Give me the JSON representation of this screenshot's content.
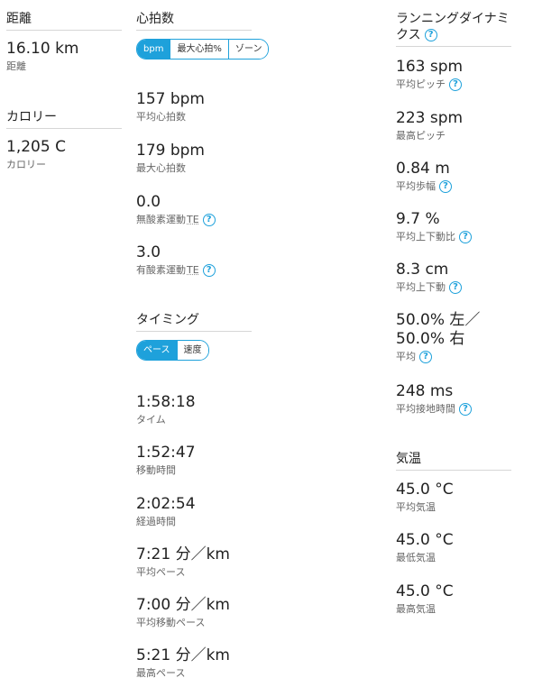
{
  "distance": {
    "title": "距離",
    "value": "16.10 km",
    "label": "距離"
  },
  "calories": {
    "title": "カロリー",
    "value": "1,205 C",
    "label": "カロリー"
  },
  "heart_rate": {
    "title": "心拍数",
    "toggle": [
      "bpm",
      "最大心拍%",
      "ゾーン"
    ],
    "stats": [
      {
        "value": "157 bpm",
        "label": "平均心拍数"
      },
      {
        "value": "179 bpm",
        "label": "最大心拍数"
      },
      {
        "value": "0.0",
        "label": "無酸素運動",
        "suffix": "TE"
      },
      {
        "value": "3.0",
        "label": "有酸素運動",
        "suffix": "TE"
      }
    ]
  },
  "timing": {
    "title": "タイミング",
    "toggle": [
      "ペース",
      "速度"
    ],
    "stats": [
      {
        "value": "1:58:18",
        "label": "タイム"
      },
      {
        "value": "1:52:47",
        "label": "移動時間"
      },
      {
        "value": "2:02:54",
        "label": "経過時間"
      },
      {
        "value": "7:21 分／km",
        "label": "平均ペース"
      },
      {
        "value": "7:00 分／km",
        "label": "平均移動ペース"
      },
      {
        "value": "5:21 分／km",
        "label": "最高ペース"
      }
    ]
  },
  "running_dynamics": {
    "title_line1": "ランニングダイナミ",
    "title_line2": "クス",
    "stats": [
      {
        "value": "163 spm",
        "label": "平均ピッチ"
      },
      {
        "value": "223 spm",
        "label": "最高ピッチ"
      },
      {
        "value": "0.84 m",
        "label": "平均歩幅"
      },
      {
        "value": "9.7 %",
        "label": "平均上下動比"
      },
      {
        "value": "8.3 cm",
        "label": "平均上下動"
      },
      {
        "value_line1": "50.0% 左／",
        "value_line2": "50.0% 右",
        "label": "平均"
      },
      {
        "value": "248 ms",
        "label": "平均接地時間"
      }
    ]
  },
  "temperature": {
    "title": "気温",
    "stats": [
      {
        "value": "45.0 °C",
        "label": "平均気温"
      },
      {
        "value": "45.0 °C",
        "label": "最低気温"
      },
      {
        "value": "45.0 °C",
        "label": "最高気温"
      }
    ]
  },
  "help_glyph": "?",
  "colors": {
    "accent": "#1ea1db"
  }
}
